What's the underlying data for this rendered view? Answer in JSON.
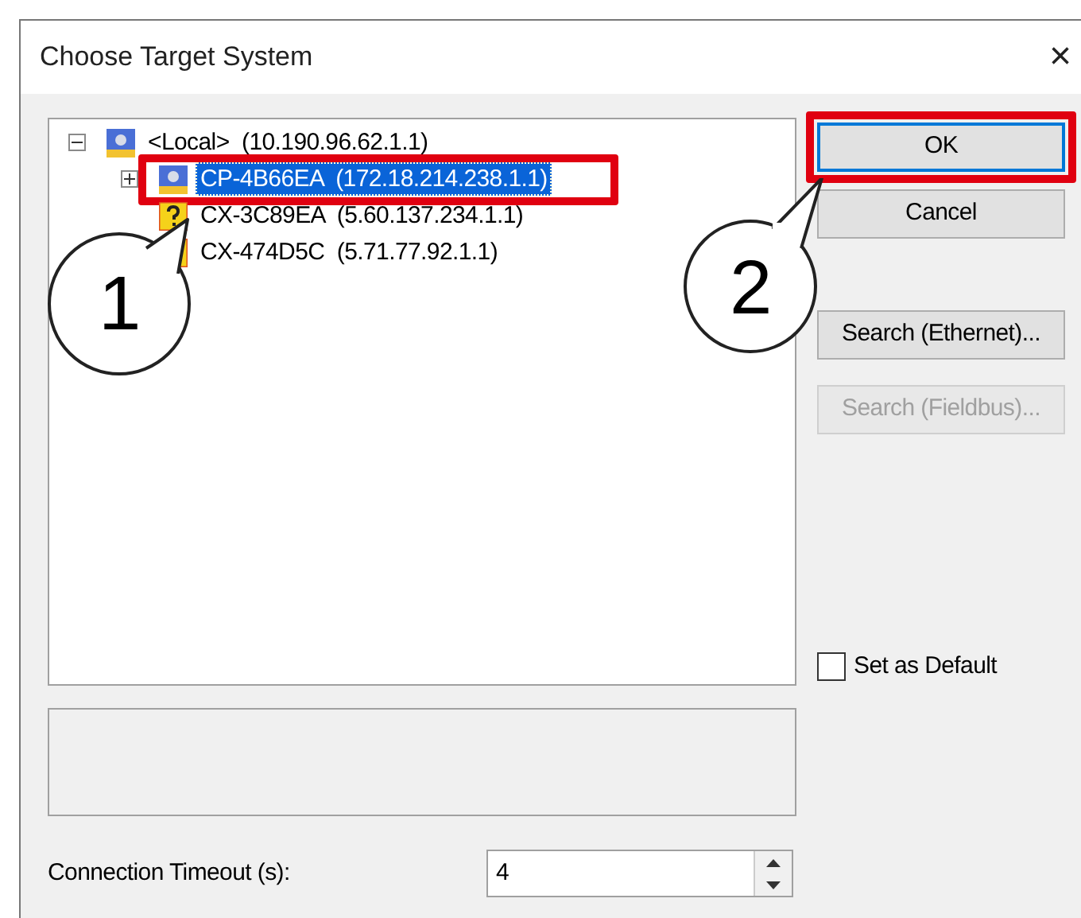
{
  "window": {
    "title": "Choose Target System",
    "close": "×"
  },
  "tree": {
    "label": "<Local>  (10.190.96.62.1.1)",
    "kind": "device",
    "expanded": true,
    "selected": false,
    "children": [
      {
        "label": "CP-4B66EA  (172.18.214.238.1.1)",
        "kind": "device",
        "expanded": false,
        "selected": true,
        "highlighted": true
      },
      {
        "label": "CX-3C89EA  (5.60.137.234.1.1)",
        "kind": "unknown",
        "selected": false,
        "highlighted": false
      },
      {
        "label": "CX-474D5C  (5.71.77.92.1.1)",
        "kind": "unknown",
        "selected": false,
        "highlighted": false
      }
    ]
  },
  "buttons": [
    {
      "label": "OK",
      "disabled": false,
      "default": true,
      "highlighted": true
    },
    {
      "label": "Cancel",
      "disabled": false,
      "default": false,
      "highlighted": false
    },
    {
      "label": "Search (Ethernet)...",
      "disabled": false,
      "default": false,
      "highlighted": false
    },
    {
      "label": "Search (Fieldbus)...",
      "disabled": true,
      "default": false,
      "highlighted": false
    }
  ],
  "set_as_default": {
    "label": "Set as Default",
    "checked": false
  },
  "timeout": {
    "label": "Connection Timeout (s):",
    "value": "4"
  },
  "callouts": [
    {
      "label": "1"
    },
    {
      "label": "2"
    }
  ]
}
